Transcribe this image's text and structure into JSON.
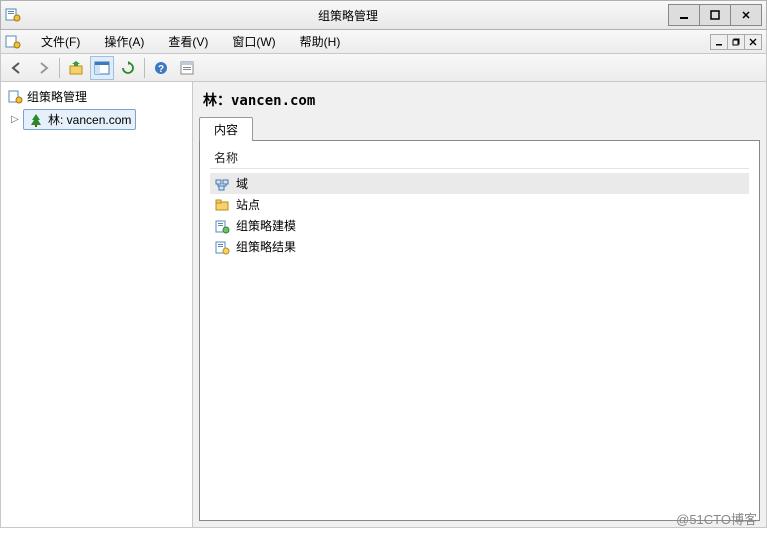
{
  "window": {
    "title": "组策略管理"
  },
  "menu": {
    "file": "文件(F)",
    "action": "操作(A)",
    "view": "查看(V)",
    "window": "窗口(W)",
    "help": "帮助(H)"
  },
  "tree": {
    "root": "组策略管理",
    "forest": "林: vancen.com"
  },
  "detail": {
    "heading_prefix": "林：",
    "heading_domain": "vancen.com",
    "tab_content": "内容",
    "col_name": "名称",
    "items": {
      "domains": "域",
      "sites": "站点",
      "modeling": "组策略建模",
      "results": "组策略结果"
    }
  },
  "watermark": "@51CTO博客"
}
